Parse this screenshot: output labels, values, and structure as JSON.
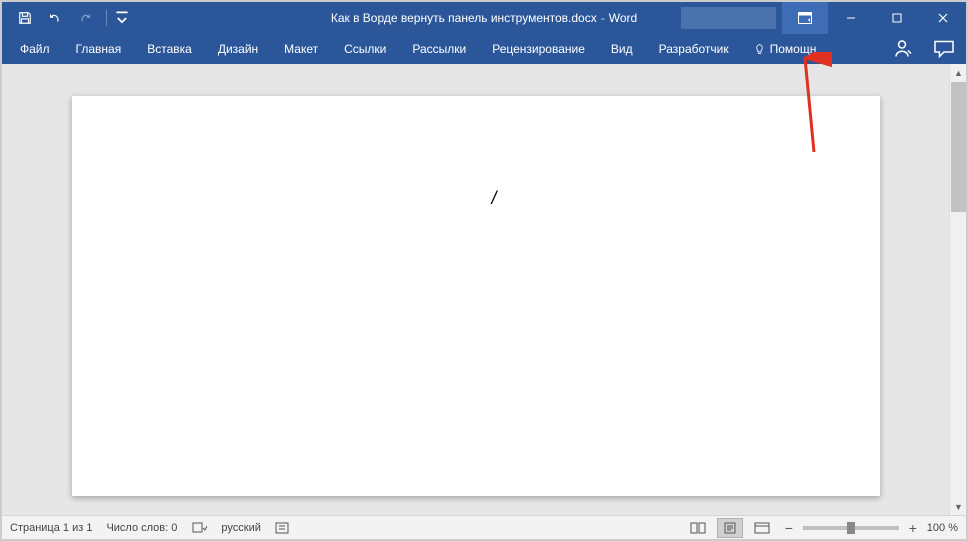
{
  "title": {
    "filename": "Как в Ворде вернуть панель инструментов.docx",
    "sep": "-",
    "app": "Word"
  },
  "tabs": {
    "file": "Файл",
    "home": "Главная",
    "insert": "Вставка",
    "design": "Дизайн",
    "layout": "Макет",
    "references": "Ссылки",
    "mailings": "Рассылки",
    "review": "Рецензирование",
    "view": "Вид",
    "developer": "Разработчик",
    "tellme": "Помощн"
  },
  "status": {
    "page": "Страница 1 из 1",
    "words": "Число слов: 0",
    "lang": "русский",
    "zoom": "100 %"
  },
  "doc": {
    "cursor_glyph": "/"
  },
  "zoom_controls": {
    "minus": "−",
    "plus": "+"
  }
}
